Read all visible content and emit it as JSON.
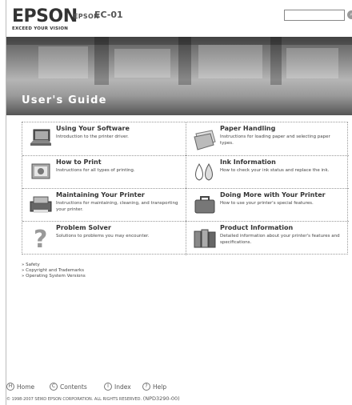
{
  "header": {
    "logo": "EPSON",
    "logo_tagline": "EXCEED YOUR VISION",
    "brand_small": "EPSON",
    "model": "EC-01",
    "search": {
      "value": "",
      "placeholder": ""
    }
  },
  "banner": {
    "title": "User's Guide"
  },
  "sections": [
    {
      "title": "Using Your Software",
      "desc": "Introduction to the printer driver.",
      "icon": "laptop-icon"
    },
    {
      "title": "Paper Handling",
      "desc": "Instructions for loading paper and selecting paper types.",
      "icon": "paper-icon"
    },
    {
      "title": "How to Print",
      "desc": "Instructions for all types of printing.",
      "icon": "print-icon"
    },
    {
      "title": "Ink Information",
      "desc": "How to check your ink status and replace the ink.",
      "icon": "ink-drops-icon"
    },
    {
      "title": "Maintaining Your Printer",
      "desc": "Instructions for maintaining, cleaning, and transporting your printer.",
      "icon": "printer-icon"
    },
    {
      "title": "Doing More with Your Printer",
      "desc": "How to use your printer's special features.",
      "icon": "bag-icon"
    },
    {
      "title": "Problem Solver",
      "desc": "Solutions to problems you may encounter.",
      "icon": "question-icon"
    },
    {
      "title": "Product Information",
      "desc": "Detailed information about your printer's features and specifications.",
      "icon": "files-icon"
    }
  ],
  "links": [
    "Safety",
    "Copyright and Trademarks",
    "Operating System Versions"
  ],
  "nav": [
    {
      "label": "Home",
      "icon": "H"
    },
    {
      "label": "Contents",
      "icon": "C"
    },
    {
      "label": "Index",
      "icon": "I"
    },
    {
      "label": "Help",
      "icon": "?"
    }
  ],
  "footer": {
    "copyright": "© 1998-2007 SEIKO EPSON CORPORATION. ALL RIGHTS RESERVED.",
    "code": "(NPD3290-00)"
  }
}
